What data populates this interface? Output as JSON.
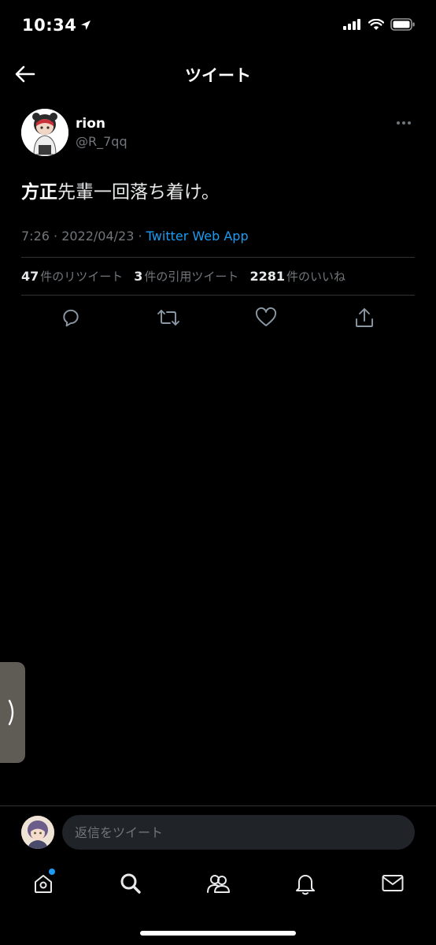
{
  "status_bar": {
    "time": "10:34"
  },
  "header": {
    "title": "ツイート"
  },
  "tweet": {
    "author_name": "rion",
    "author_handle": "@R_7qq",
    "text_bold": "方正",
    "text_rest": "先輩一回落ち着け。",
    "timestamp": "7:26 · 2022/04/23 · ",
    "source": "Twitter Web App"
  },
  "stats": {
    "retweets_count": "47",
    "retweets_label": "件のリツイート",
    "quotes_count": "3",
    "quotes_label": "件の引用ツイート",
    "likes_count": "2281",
    "likes_label": "件のいいね"
  },
  "reply": {
    "placeholder": "返信をツイート"
  },
  "icons": {
    "back": "arrow-left-icon",
    "more": "more-horizontal-icon",
    "reply": "comment-icon",
    "retweet": "retweet-icon",
    "like": "heart-icon",
    "share": "share-icon",
    "home": "home-icon",
    "search": "search-icon",
    "communities": "communities-icon",
    "notifications": "bell-icon",
    "messages": "envelope-icon"
  },
  "colors": {
    "background": "#000000",
    "accent": "#1d9bf0",
    "secondary_text": "#71767b"
  }
}
